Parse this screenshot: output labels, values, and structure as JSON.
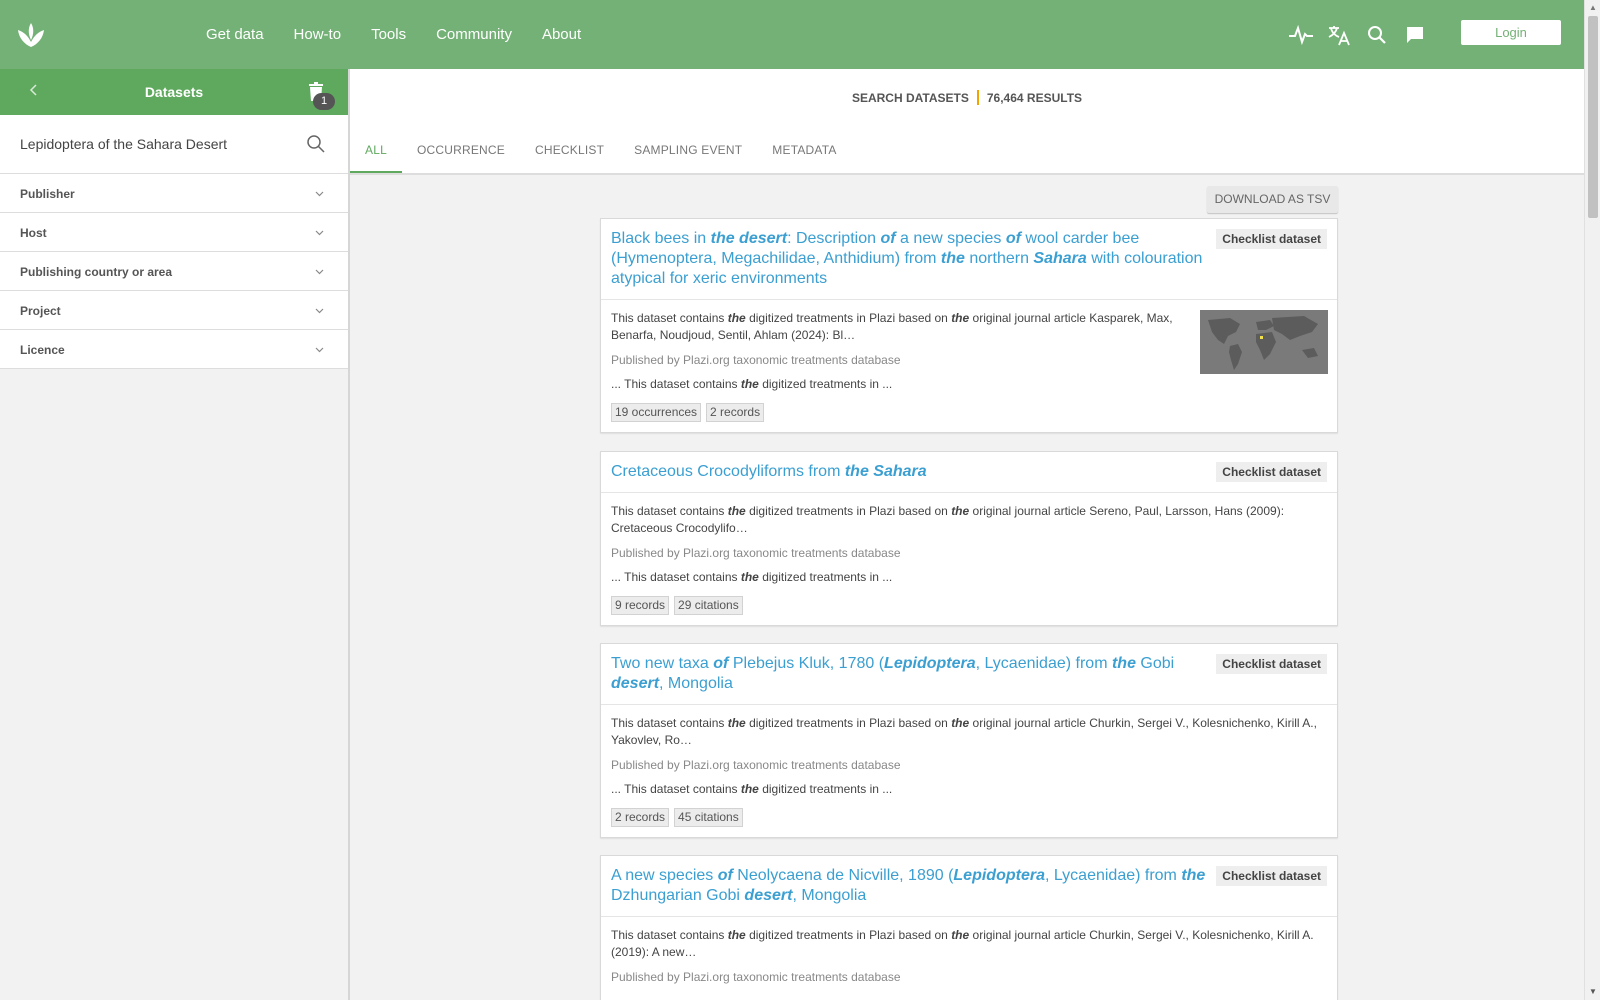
{
  "nav": [
    "Get data",
    "How-to",
    "Tools",
    "Community",
    "About"
  ],
  "login_label": "Login",
  "sidebar": {
    "title": "Datasets",
    "badge_count": "1",
    "search_value": "Lepidoptera of the Sahara Desert",
    "filters": [
      "Publisher",
      "Host",
      "Publishing country or area",
      "Project",
      "Licence"
    ]
  },
  "summary": {
    "label": "SEARCH DATASETS",
    "count": "76,464 RESULTS"
  },
  "tabs": [
    "ALL",
    "OCCURRENCE",
    "CHECKLIST",
    "SAMPLING EVENT",
    "METADATA"
  ],
  "download_label": "DOWNLOAD AS TSV",
  "results": [
    {
      "title": [
        [
          "Black bees in ",
          0
        ],
        [
          "the desert",
          1
        ],
        [
          ": Description ",
          0
        ],
        [
          "of",
          1
        ],
        [
          " a new species ",
          0
        ],
        [
          "of",
          1
        ],
        [
          " wool carder bee (Hymenoptera, Megachilidae, Anthidium) from ",
          0
        ],
        [
          "the",
          1
        ],
        [
          " northern ",
          0
        ],
        [
          "Sahara",
          1
        ],
        [
          " with colouration atypical for xeric environments",
          0
        ]
      ],
      "type": "Checklist dataset",
      "description": [
        [
          "This dataset contains ",
          0
        ],
        [
          "the",
          1
        ],
        [
          " digitized treatments in Plazi based on ",
          0
        ],
        [
          "the",
          1
        ],
        [
          " original journal article Kasparek, Max, Benarfa, Noudjoud, Sentil, Ahlam (2024): Bl…",
          0
        ]
      ],
      "publisher": "Published by Plazi.org taxonomic treatments database",
      "snippet": [
        [
          "... This dataset contains ",
          0
        ],
        [
          "the",
          1
        ],
        [
          " digitized treatments in ...",
          0
        ]
      ],
      "chips": [
        "19 occurrences",
        "2 records"
      ],
      "has_map": true
    },
    {
      "title": [
        [
          "Cretaceous Crocodyliforms from ",
          0
        ],
        [
          "the Sahara",
          1
        ]
      ],
      "type": "Checklist dataset",
      "description": [
        [
          "This dataset contains ",
          0
        ],
        [
          "the",
          1
        ],
        [
          " digitized treatments in Plazi based on ",
          0
        ],
        [
          "the",
          1
        ],
        [
          " original journal article Sereno, Paul, Larsson, Hans (2009): Cretaceous Crocodylifo…",
          0
        ]
      ],
      "publisher": "Published by Plazi.org taxonomic treatments database",
      "snippet": [
        [
          "... This dataset contains ",
          0
        ],
        [
          "the",
          1
        ],
        [
          " digitized treatments in ...",
          0
        ]
      ],
      "chips": [
        "9 records",
        "29 citations"
      ],
      "has_map": false
    },
    {
      "title": [
        [
          "Two new taxa ",
          0
        ],
        [
          "of",
          1
        ],
        [
          " Plebejus Kluk, 1780 (",
          0
        ],
        [
          "Lepidoptera",
          1
        ],
        [
          ", Lycaenidae) from ",
          0
        ],
        [
          "the",
          1
        ],
        [
          " Gobi ",
          0
        ],
        [
          "desert",
          1
        ],
        [
          ", Mongolia",
          0
        ]
      ],
      "type": "Checklist dataset",
      "description": [
        [
          "This dataset contains ",
          0
        ],
        [
          "the",
          1
        ],
        [
          " digitized treatments in Plazi based on ",
          0
        ],
        [
          "the",
          1
        ],
        [
          " original journal article Churkin, Sergei V., Kolesnichenko, Kirill A., Yakovlev, Ro…",
          0
        ]
      ],
      "publisher": "Published by Plazi.org taxonomic treatments database",
      "snippet": [
        [
          "... This dataset contains ",
          0
        ],
        [
          "the",
          1
        ],
        [
          " digitized treatments in ...",
          0
        ]
      ],
      "chips": [
        "2 records",
        "45 citations"
      ],
      "has_map": false
    },
    {
      "title": [
        [
          "A new species ",
          0
        ],
        [
          "of",
          1
        ],
        [
          " Neolycaena de Nicville, 1890 (",
          0
        ],
        [
          "Lepidoptera",
          1
        ],
        [
          ", Lycaenidae) from ",
          0
        ],
        [
          "the",
          1
        ],
        [
          " Dzhungarian Gobi ",
          0
        ],
        [
          "desert",
          1
        ],
        [
          ", Mongolia",
          0
        ]
      ],
      "type": "Checklist dataset",
      "description": [
        [
          "This dataset contains ",
          0
        ],
        [
          "the",
          1
        ],
        [
          " digitized treatments in Plazi based on ",
          0
        ],
        [
          "the",
          1
        ],
        [
          " original journal article Churkin, Sergei V., Kolesnichenko, Kirill A. (2019): A new…",
          0
        ]
      ],
      "publisher": "Published by Plazi.org taxonomic treatments database",
      "snippet": [],
      "chips": [],
      "has_map": false
    }
  ],
  "colors": {
    "header_green": "#74b176",
    "sidebar_green": "#5fa95e",
    "link_blue": "#3b9fd1",
    "accent_orange": "#f0a400"
  }
}
